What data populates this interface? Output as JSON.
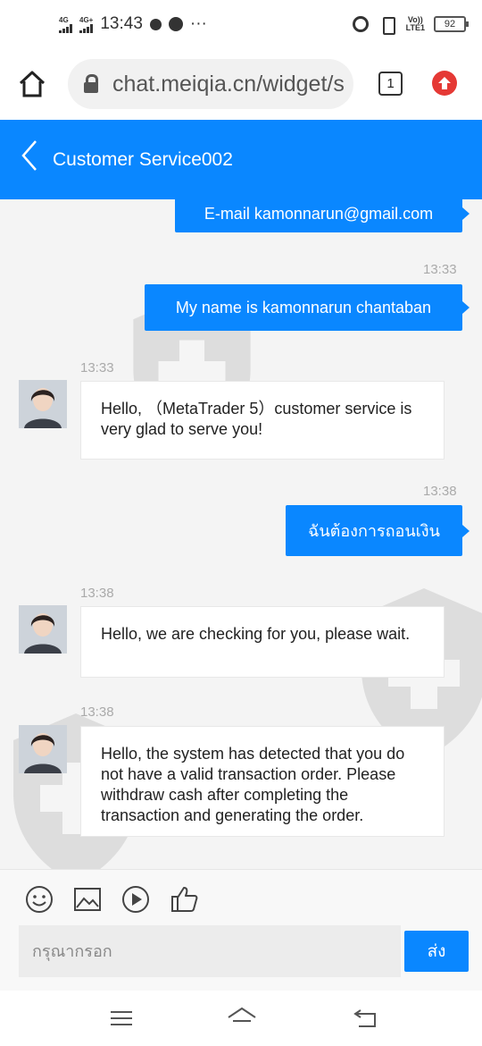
{
  "status_bar": {
    "network1": "4G",
    "network2": "4G+",
    "time": "13:43",
    "more": "···",
    "volte": "Vo))\nLTE1",
    "battery": "92"
  },
  "browser": {
    "url": "chat.meiqia.cn/widget/s",
    "tab_count": "1"
  },
  "header": {
    "title": "Customer Service002"
  },
  "messages": [
    {
      "type": "out",
      "text": "E-mail kamonnarun@gmail.com"
    },
    {
      "time": "13:33"
    },
    {
      "type": "out",
      "text": "My name is kamonnarun chantaban"
    },
    {
      "time": "13:33"
    },
    {
      "type": "in",
      "text": "Hello, （MetaTrader 5）customer service is very glad to serve you!"
    },
    {
      "time": "13:38"
    },
    {
      "type": "out",
      "text": "ฉันต้องการถอนเงิน"
    },
    {
      "time": "13:38"
    },
    {
      "type": "in",
      "text": "Hello, we are checking for you, please wait."
    },
    {
      "time": "13:38"
    },
    {
      "type": "in",
      "text": "Hello, the system has detected that you do not have a valid transaction order. Please withdraw cash after completing the transaction and generating the order."
    }
  ],
  "input": {
    "placeholder": "กรุณากรอก",
    "send_label": "ส่ง"
  },
  "colors": {
    "accent": "#0a87ff",
    "chat_bg": "#f4f4f4",
    "update_badge": "#e53935"
  },
  "icons": {
    "toolbar": [
      "emoji-icon",
      "image-icon",
      "video-icon",
      "thumbs-up-icon"
    ],
    "nav": [
      "menu-icon",
      "home-icon",
      "back-icon"
    ]
  }
}
